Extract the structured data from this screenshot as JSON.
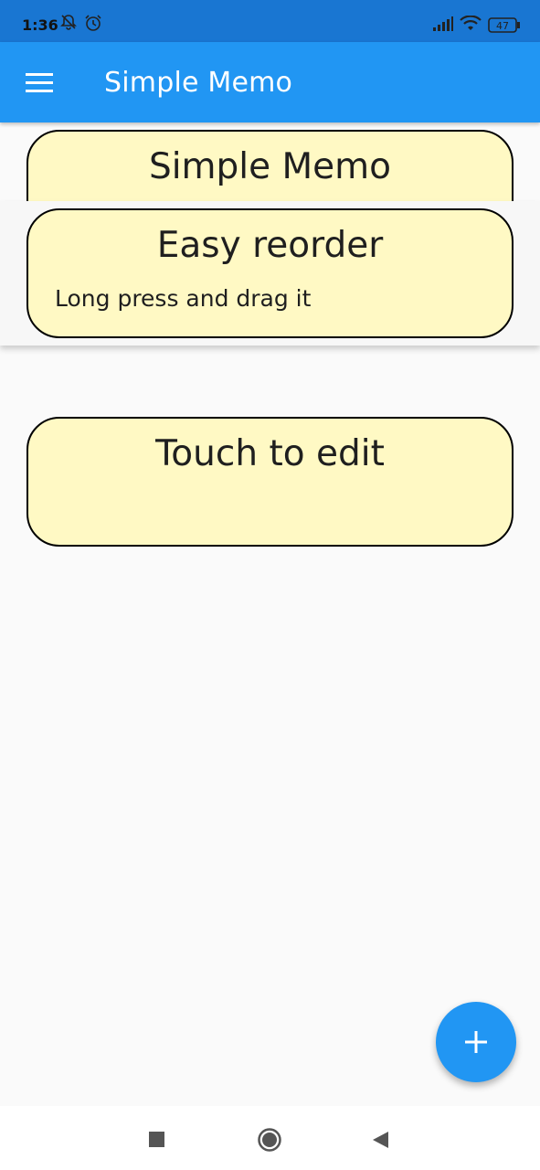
{
  "status_bar": {
    "time": "1:36",
    "battery": "47",
    "icons": [
      "mute-bell-icon",
      "alarm-icon",
      "signal-icon",
      "wifi-icon",
      "battery-icon"
    ]
  },
  "app_bar": {
    "title": "Simple Memo",
    "menu_icon": "hamburger-menu-icon",
    "color": "#2196f3"
  },
  "memos": [
    {
      "title": "Simple Memo",
      "body": ""
    },
    {
      "title": "Easy reorder",
      "body": "Long press and drag it"
    },
    {
      "title": "Touch to edit",
      "body": ""
    }
  ],
  "memo_style": {
    "background": "#fff9c4",
    "border": "#000000"
  },
  "fab": {
    "icon": "add-icon",
    "color": "#2196f3"
  },
  "nav_bar": {
    "icons": [
      "recents-square-icon",
      "home-circle-icon",
      "back-triangle-icon"
    ]
  }
}
